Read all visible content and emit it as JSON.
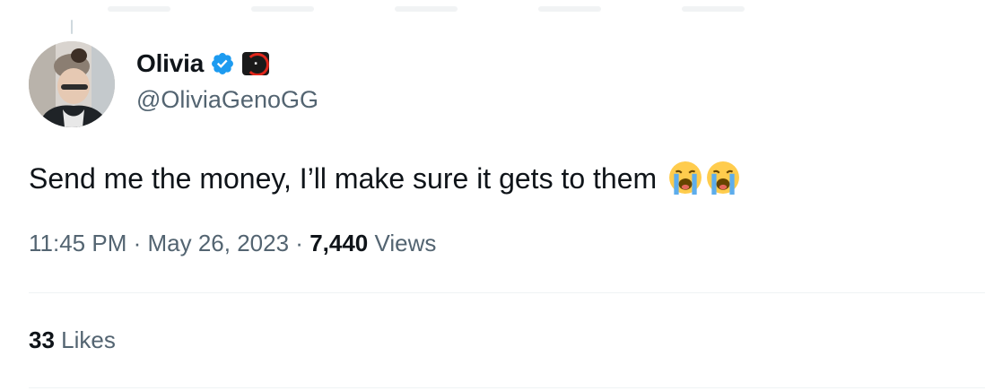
{
  "author": {
    "display_name": "Olivia",
    "handle": "@OliviaGenoGG",
    "verified_icon": "verified-badge-icon",
    "affiliation_icon": "org-affiliation-badge"
  },
  "tweet": {
    "text": "Send me the money, I’ll make sure it gets to them",
    "emojis": [
      "loudly-crying-face",
      "loudly-crying-face"
    ]
  },
  "meta": {
    "time": "11:45 PM",
    "separator": "·",
    "date": "May 26, 2023",
    "views_count": "7,440",
    "views_label": "Views"
  },
  "engagement": {
    "likes_count": "33",
    "likes_label": "Likes"
  },
  "colors": {
    "text": "#0f1419",
    "secondary": "#536471",
    "verified": "#1d9bf0",
    "divider": "#eff3f4"
  }
}
